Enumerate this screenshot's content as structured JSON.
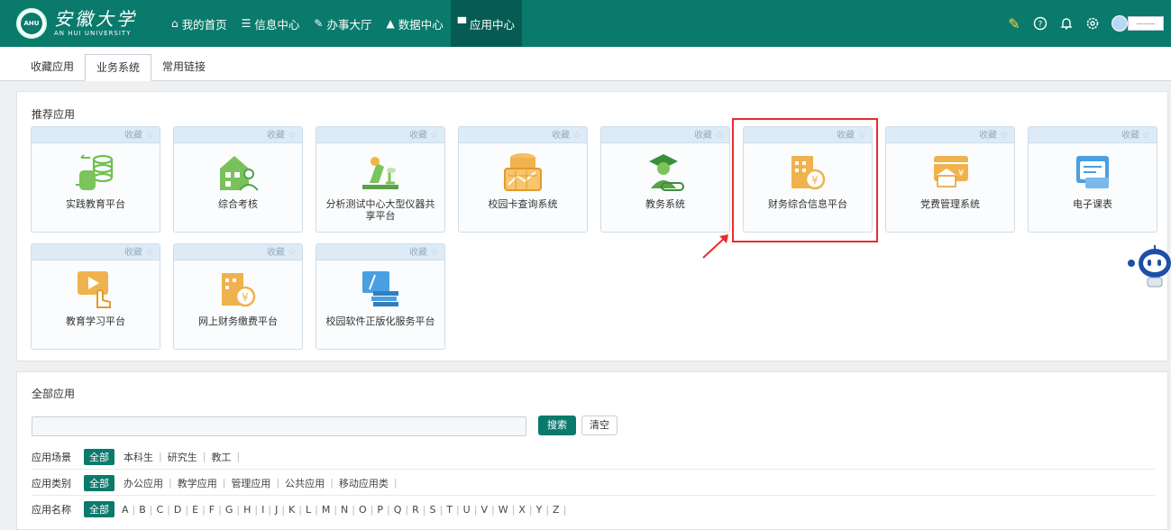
{
  "header": {
    "logo_cn": "安徽大学",
    "logo_en": "AN HUI UNIVERSITY",
    "seal_text": "AHU",
    "nav": [
      {
        "label": "我的首页",
        "icon": "home-icon"
      },
      {
        "label": "信息中心",
        "icon": "list-icon"
      },
      {
        "label": "办事大厅",
        "icon": "edit-icon"
      },
      {
        "label": "数据中心",
        "icon": "chart-icon"
      },
      {
        "label": "应用中心",
        "icon": "cart-icon"
      }
    ],
    "right_icons": [
      "note-edit-icon",
      "help-icon",
      "bell-icon",
      "gear-icon",
      "user-avatar-icon"
    ],
    "user_name": "———",
    "bar_color": "#0a7a6c"
  },
  "tabs": [
    {
      "label": "收藏应用"
    },
    {
      "label": "业务系统",
      "active": true
    },
    {
      "label": "常用链接"
    }
  ],
  "recommended": {
    "title": "推荐应用",
    "fav_label": "收藏",
    "apps": [
      {
        "name": "实践教育平台",
        "icon": "database-sync-icon"
      },
      {
        "name": "综合考核",
        "icon": "building-person-icon"
      },
      {
        "name": "分析测试中心大型仪器共享平台",
        "icon": "microscope-icon"
      },
      {
        "name": "校园卡查询系统",
        "icon": "card-query-icon"
      },
      {
        "name": "教务系统",
        "icon": "graduate-icon"
      },
      {
        "name": "财务综合信息平台",
        "icon": "finance-building-icon",
        "highlighted": true
      },
      {
        "name": "党费管理系统",
        "icon": "party-fee-icon"
      },
      {
        "name": "电子课表",
        "icon": "schedule-icon"
      },
      {
        "name": "教育学习平台",
        "icon": "video-learning-icon"
      },
      {
        "name": "网上财务缴费平台",
        "icon": "online-payment-icon"
      },
      {
        "name": "校园软件正版化服务平台",
        "icon": "software-books-icon"
      }
    ]
  },
  "all_apps": {
    "title": "全部应用",
    "search_placeholder": "",
    "search_button": "搜索",
    "clear_button": "清空",
    "filters": [
      {
        "label": "应用场景",
        "options": [
          "全部",
          "本科生",
          "研究生",
          "教工"
        ]
      },
      {
        "label": "应用类别",
        "options": [
          "全部",
          "办公应用",
          "教学应用",
          "管理应用",
          "公共应用",
          "移动应用类"
        ]
      },
      {
        "label": "应用名称",
        "options": [
          "全部",
          "A",
          "B",
          "C",
          "D",
          "E",
          "F",
          "G",
          "H",
          "I",
          "J",
          "K",
          "L",
          "M",
          "N",
          "O",
          "P",
          "Q",
          "R",
          "S",
          "T",
          "U",
          "V",
          "W",
          "X",
          "Y",
          "Z"
        ]
      }
    ]
  },
  "assistant": {
    "icon": "robot-assistant-icon"
  }
}
